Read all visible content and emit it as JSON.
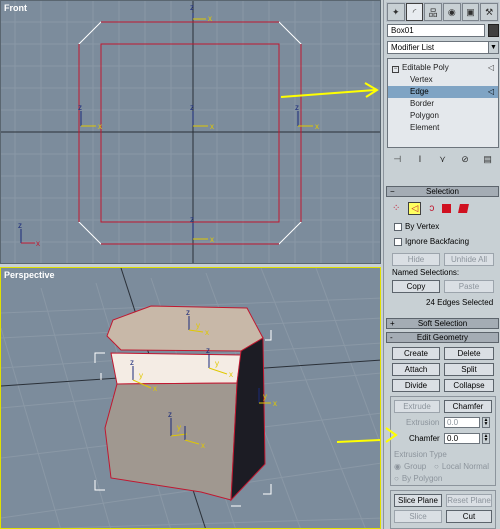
{
  "viewports": {
    "front": {
      "label": "Front"
    },
    "perspective": {
      "label": "Perspective"
    }
  },
  "axis_labels": {
    "x": "x",
    "y": "y",
    "z": "z"
  },
  "panel": {
    "object_name": "Box01",
    "modifier_list": "Modifier List",
    "stack": {
      "root": "Editable Poly",
      "items": [
        "Vertex",
        "Edge",
        "Border",
        "Polygon",
        "Element"
      ],
      "selected": "Edge"
    },
    "selection": {
      "title": "Selection",
      "by_vertex": "By Vertex",
      "ignore_backfacing": "Ignore Backfacing",
      "hide": "Hide",
      "unhide_all": "Unhide All",
      "named_selections": "Named Selections:",
      "copy": "Copy",
      "paste": "Paste",
      "status": "24 Edges Selected"
    },
    "soft_selection": {
      "title": "Soft Selection",
      "sign": "+"
    },
    "edit_geometry": {
      "title": "Edit Geometry",
      "sign": "-",
      "create": "Create",
      "delete": "Delete",
      "attach": "Attach",
      "split": "Split",
      "divide": "Divide",
      "collapse": "Collapse",
      "extrude": "Extrude",
      "chamfer": "Chamfer",
      "extrusion_label": "Extrusion",
      "extrusion_value": "0.0",
      "chamfer_label": "Chamfer",
      "chamfer_value": "0.0",
      "extrusion_type": "Extrusion Type",
      "group": "Group",
      "local_normal": "Local Normal",
      "by_polygon": "By Polygon",
      "slice_plane": "Slice Plane",
      "reset_plane": "Reset Plane",
      "slice": "Slice",
      "cut": "Cut"
    }
  },
  "colors": {
    "viewport_bg": "#7c8c9c",
    "edge_selected": "#c01830",
    "annotation_arrow": "#ffff00",
    "stack_selected": "#7fa4c4"
  }
}
